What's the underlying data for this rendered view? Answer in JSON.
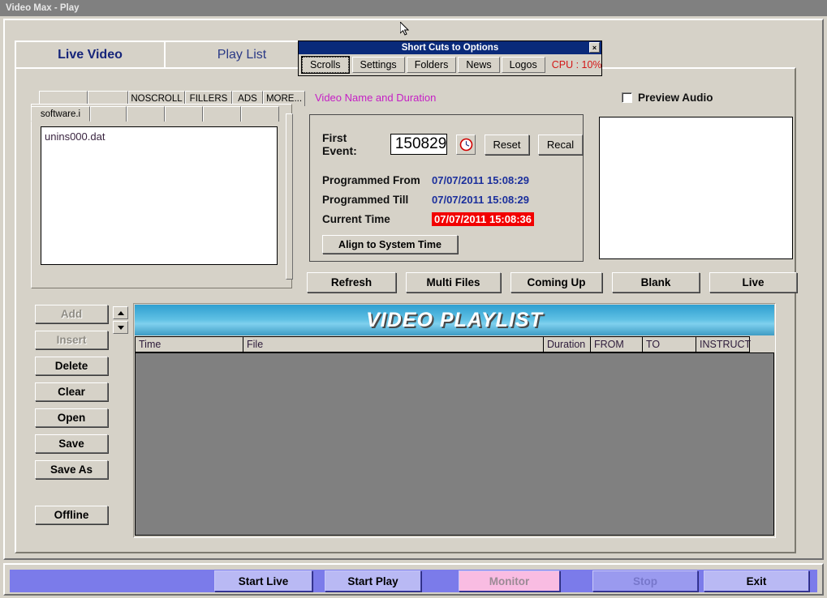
{
  "window": {
    "title": "Video Max - Play"
  },
  "tabs": [
    {
      "label": "Live Video",
      "selected": true
    },
    {
      "label": "Play List",
      "selected": false
    }
  ],
  "shortcuts_dialog": {
    "title": "Short Cuts to Options",
    "close_label": "×",
    "buttons": [
      {
        "label": "Scrolls",
        "active": true
      },
      {
        "label": "Settings",
        "active": false
      },
      {
        "label": "Folders",
        "active": false
      },
      {
        "label": "News",
        "active": false
      },
      {
        "label": "Logos",
        "active": false
      }
    ],
    "cpu_label": "CPU : 10%",
    "cpu_color": "#d31717"
  },
  "file_browser": {
    "category_tabs": [
      "",
      "",
      "NOSCROLL",
      "FILLERS",
      "ADS",
      "MORE..."
    ],
    "folder_tabs": [
      {
        "label": "software.i",
        "selected": true
      },
      {
        "label": "",
        "selected": false
      },
      {
        "label": "",
        "selected": false
      },
      {
        "label": "",
        "selected": false
      },
      {
        "label": "",
        "selected": false
      },
      {
        "label": "",
        "selected": false
      }
    ],
    "files": [
      "unins000.dat"
    ]
  },
  "video_panel": {
    "section_label": "Video Name and Duration",
    "section_label_color": "#c51fc5",
    "preview_audio_label": "Preview Audio",
    "preview_audio_checked": false,
    "first_event_label": "First Event:",
    "first_event_value": "150829",
    "clock_icon": "clock-icon",
    "reset_label": "Reset",
    "recal_label": "Recal",
    "programmed_from_label": "Programmed From",
    "programmed_from_value": "07/07/2011 15:08:29",
    "programmed_till_label": "Programmed Till",
    "programmed_till_value": "07/07/2011 15:08:29",
    "current_time_label": "Current Time",
    "current_time_value": "07/07/2011 15:08:36",
    "current_time_bg": "#f20000",
    "align_label": "Align to System Time"
  },
  "action_buttons": [
    {
      "label": "Refresh"
    },
    {
      "label": "Multi Files"
    },
    {
      "label": "Coming Up"
    },
    {
      "label": "Blank"
    },
    {
      "label": "Live"
    }
  ],
  "edit_buttons": [
    {
      "label": "Add",
      "enabled": false
    },
    {
      "label": "Insert",
      "enabled": false
    },
    {
      "label": "Delete",
      "enabled": true
    },
    {
      "label": "Clear",
      "enabled": true
    },
    {
      "label": "Open",
      "enabled": true
    },
    {
      "label": "Save",
      "enabled": true
    },
    {
      "label": "Save As",
      "enabled": true
    }
  ],
  "offline_button": {
    "label": "Offline"
  },
  "playlist": {
    "banner": "VIDEO PLAYLIST",
    "columns": [
      "Time",
      "File",
      "Duration",
      "FROM",
      "TO",
      "INSTRUCT"
    ],
    "rows": []
  },
  "bottom_bar": {
    "buttons": [
      {
        "label": "Start Live",
        "enabled": true
      },
      {
        "label": "Start Play",
        "enabled": true
      },
      {
        "label": "Monitor",
        "enabled": false
      },
      {
        "label": "Stop",
        "enabled": false
      },
      {
        "label": "Exit",
        "enabled": true
      }
    ]
  }
}
